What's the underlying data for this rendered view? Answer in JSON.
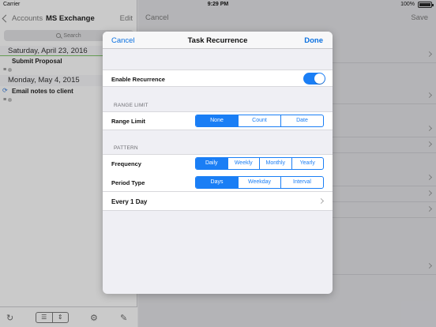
{
  "status_bar": {
    "carrier": "Carrier",
    "time": "9:29 PM",
    "battery": "100%"
  },
  "left": {
    "back_label": "Accounts",
    "title": "MS Exchange",
    "edit_label": "Edit",
    "search_placeholder": "Search",
    "sections": [
      {
        "date": "Saturday, April 23, 2016",
        "task": "Submit Proposal"
      },
      {
        "date": "Monday, May 4, 2015",
        "task": "Email notes to client"
      }
    ],
    "toolbar": {
      "refresh_icon": "refresh-icon",
      "sort_icon": "sort-icon",
      "settings_icon": "gear-icon",
      "compose_icon": "compose-icon"
    }
  },
  "right": {
    "cancel_label": "Cancel",
    "save_label": "Save"
  },
  "modal": {
    "cancel_label": "Cancel",
    "title": "Task Recurrence",
    "done_label": "Done",
    "enable_label": "Enable Recurrence",
    "enable_on": true,
    "range_group": "RANGE LIMIT",
    "range_label": "Range Limit",
    "range_options": [
      "None",
      "Count",
      "Date"
    ],
    "range_selected": "None",
    "pattern_group": "PATTERN",
    "frequency_label": "Frequency",
    "frequency_options": [
      "Daily",
      "Weekly",
      "Monthly",
      "Yearly"
    ],
    "frequency_selected": "Daily",
    "period_label": "Period Type",
    "period_options": [
      "Days",
      "Weekday",
      "Interval"
    ],
    "period_selected": "Days",
    "every_label": "Every 1 Day"
  },
  "colors": {
    "accent": "#1a7ef5",
    "link": "#0a70e0"
  }
}
